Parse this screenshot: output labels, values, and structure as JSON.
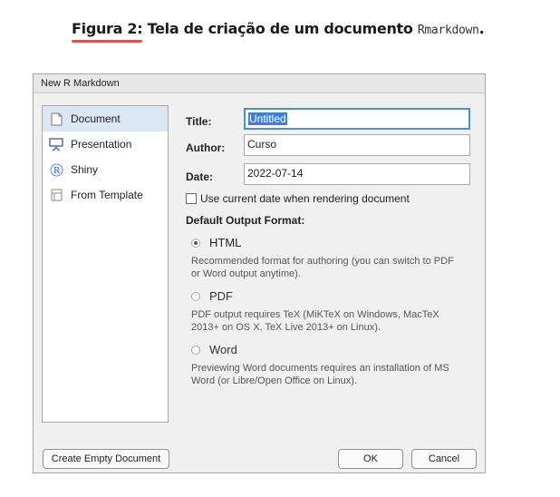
{
  "caption": {
    "prefix": "Figura 2:",
    "text": "Tela de criação de um documento",
    "code": "Rmarkdown",
    "suffix": "."
  },
  "dialog": {
    "title": "New R Markdown",
    "sidebar": [
      {
        "label": "Document",
        "icon": "document-icon",
        "selected": true
      },
      {
        "label": "Presentation",
        "icon": "presentation-icon",
        "selected": false
      },
      {
        "label": "Shiny",
        "icon": "shiny-r-icon",
        "selected": false
      },
      {
        "label": "From Template",
        "icon": "template-icon",
        "selected": false
      }
    ],
    "fields": {
      "title_label": "Title:",
      "title_value": "Untitled",
      "author_label": "Author:",
      "author_value": "Curso",
      "date_label": "Date:",
      "date_value": "2022-07-14"
    },
    "use_current_date_label": "Use current date when rendering document",
    "default_output_label": "Default Output Format:",
    "formats": [
      {
        "name": "HTML",
        "selected": true,
        "desc": "Recommended format for authoring (you can switch to PDF or Word output anytime)."
      },
      {
        "name": "PDF",
        "selected": false,
        "desc": "PDF output requires TeX (MiKTeX on Windows, MacTeX 2013+ on OS X, TeX Live 2013+ on Linux)."
      },
      {
        "name": "Word",
        "selected": false,
        "desc": "Previewing Word documents requires an installation of MS Word (or Libre/Open Office on Linux)."
      }
    ],
    "buttons": {
      "create_empty": "Create Empty Document",
      "ok": "OK",
      "cancel": "Cancel"
    },
    "colors": {
      "accent": "#3f7ed4",
      "selected_bg": "#dbe6f3",
      "caption_underline": "#d9534f"
    }
  }
}
